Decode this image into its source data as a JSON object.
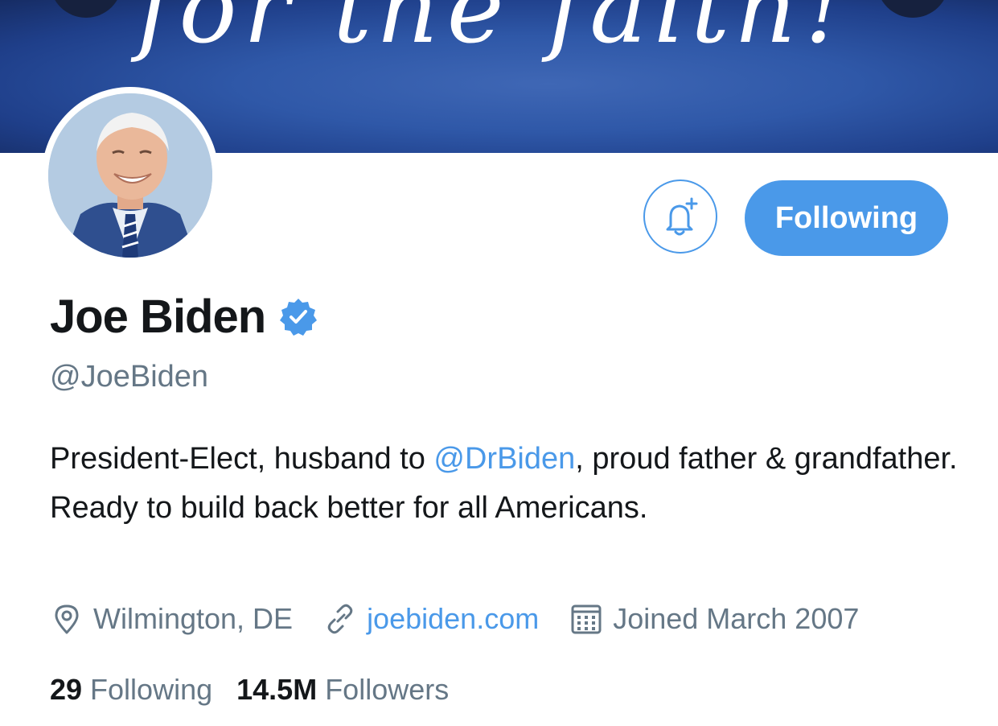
{
  "banner": {
    "text": "for the faith!"
  },
  "profile": {
    "name": "Joe Biden",
    "handle": "@JoeBiden",
    "verified": true,
    "bio_part1": "President-Elect, husband to ",
    "bio_mention": "@DrBiden",
    "bio_part2": ", proud father & grandfather. Ready to build back better for all Americans.",
    "location": "Wilmington, DE",
    "website": "joebiden.com",
    "joined": "Joined March 2007"
  },
  "actions": {
    "notify_icon": "bell-plus-icon",
    "follow_label": "Following"
  },
  "stats": {
    "following_count": "29",
    "following_label": "Following",
    "followers_count": "14.5M",
    "followers_label": "Followers"
  },
  "colors": {
    "accent": "#4a99e9",
    "secondary_text": "#657786",
    "primary_text": "#14171a",
    "banner": "#2f58a8"
  }
}
